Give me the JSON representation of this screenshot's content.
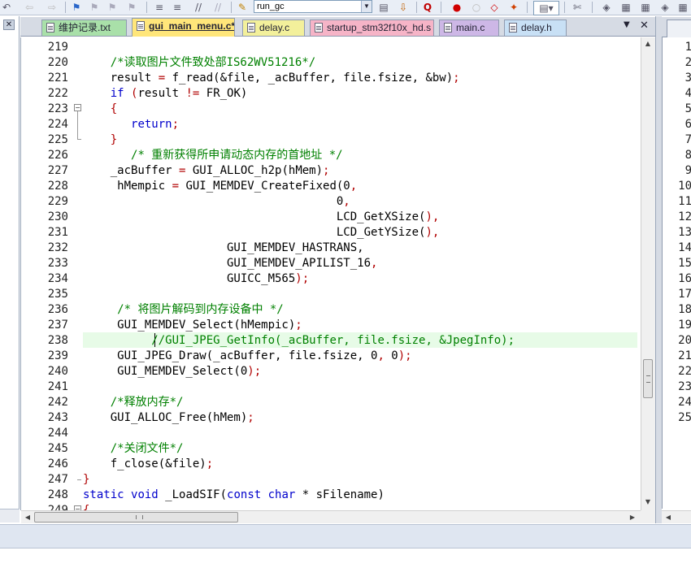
{
  "toolbar": {
    "target_value": "run_gc",
    "icons": [
      "back-icon",
      "forward-icon",
      "bookmark-icon",
      "bookmark-prev-icon",
      "bookmark-next-icon",
      "bookmark-clear-icon",
      "indent-icon",
      "unindent-icon",
      "comment-icon",
      "uncomment-icon",
      "target-options-icon",
      "load-icon",
      "find-icon",
      "debug-start-icon",
      "breakpoint-icon",
      "breakpoint-disable-icon",
      "breakpoint-kill-icon",
      "window-layout-icon",
      "tools-icon",
      "pack-installer-icon"
    ]
  },
  "left_panel": {
    "close_glyph": "✕"
  },
  "tabs": [
    {
      "label": "维护记录.txt",
      "bg": "#a9e0a9"
    },
    {
      "label": "gui_main_menu.c*",
      "bg": "#ffe67a",
      "active": true
    },
    {
      "label": "delay.c",
      "bg": "#f3f09b"
    },
    {
      "label": "startup_stm32f10x_hd.s",
      "bg": "#f6b4c7"
    },
    {
      "label": "main.c",
      "bg": "#cdb7e6"
    },
    {
      "label": "delay.h",
      "bg": "#c8e0f5"
    }
  ],
  "tab_controls": {
    "menu_glyph": "▼",
    "close_glyph": "✕"
  },
  "editor": {
    "current_line": 238,
    "lines": [
      {
        "n": "219",
        "text": ""
      },
      {
        "n": "220",
        "text": "    /*读取图片文件致处部IS62WV51216*/"
      },
      {
        "n": "221",
        "text": "    result = f_read(&file, _acBuffer, file.fsize, &bw);"
      },
      {
        "n": "222",
        "text": "    if (result != FR_OK)"
      },
      {
        "n": "223",
        "text": "    {"
      },
      {
        "n": "224",
        "text": "       return;"
      },
      {
        "n": "225",
        "text": "    }"
      },
      {
        "n": "226",
        "text": "       /* 重新获得所申请动态内存的首地址 */"
      },
      {
        "n": "227",
        "text": "    _acBuffer = GUI_ALLOC_h2p(hMem);"
      },
      {
        "n": "228",
        "text": "     hMempic = GUI_MEMDEV_CreateFixed(0,"
      },
      {
        "n": "229",
        "text": "                                     0,"
      },
      {
        "n": "230",
        "text": "                                     LCD_GetXSize(),"
      },
      {
        "n": "231",
        "text": "                                     LCD_GetYSize(),"
      },
      {
        "n": "232",
        "text": "                     GUI_MEMDEV_HASTRANS,"
      },
      {
        "n": "233",
        "text": "                     GUI_MEMDEV_APILIST_16,"
      },
      {
        "n": "234",
        "text": "                     GUICC_M565);"
      },
      {
        "n": "235",
        "text": ""
      },
      {
        "n": "236",
        "text": "     /* 将图片解码到内存设备中 */"
      },
      {
        "n": "237",
        "text": "     GUI_MEMDEV_Select(hMempic);"
      },
      {
        "n": "238",
        "text": "          //GUI_JPEG_GetInfo(_acBuffer, file.fsize, &JpegInfo);"
      },
      {
        "n": "239",
        "text": "     GUI_JPEG_Draw(_acBuffer, file.fsize, 0, 0);"
      },
      {
        "n": "240",
        "text": "     GUI_MEMDEV_Select(0);"
      },
      {
        "n": "241",
        "text": ""
      },
      {
        "n": "242",
        "text": "    /*释放内存*/"
      },
      {
        "n": "243",
        "text": "    GUI_ALLOC_Free(hMem);"
      },
      {
        "n": "244",
        "text": ""
      },
      {
        "n": "245",
        "text": "    /*关闭文件*/"
      },
      {
        "n": "246",
        "text": "    f_close(&file);"
      },
      {
        "n": "247",
        "text": "}"
      },
      {
        "n": "248",
        "text": "static void _LoadSIF(const char * sFilename)"
      },
      {
        "n": "249",
        "text": "{"
      }
    ]
  },
  "right_panel": {
    "line_numbers": [
      "1",
      "2",
      "3",
      "4",
      "5",
      "6",
      "7",
      "8",
      "9",
      "10",
      "11",
      "12",
      "13",
      "14",
      "15",
      "16",
      "17",
      "18",
      "19",
      "20",
      "21",
      "22",
      "23",
      "24",
      "25"
    ]
  },
  "scrollbars": {
    "up": "▲",
    "down": "▼",
    "left": "◀",
    "right": "▶"
  },
  "colors": {
    "current_line": "#e7fbe7",
    "comment": "#008000",
    "keyword": "#0000cc",
    "tabstrip": "#d6dbe4"
  }
}
